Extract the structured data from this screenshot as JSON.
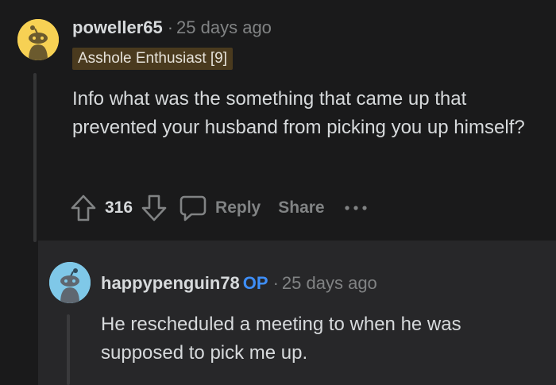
{
  "comment": {
    "username": "poweller65",
    "time_ago": "25 days ago",
    "flair": "Asshole Enthusiast [9]",
    "body": "Info what was the something that came up that prevented your husband from picking you up himself?",
    "vote_count": "316",
    "actions": {
      "reply": "Reply",
      "share": "Share",
      "more": "•••"
    },
    "avatar_color": "#f7d154"
  },
  "reply": {
    "username": "happypenguin78",
    "op_tag": "OP",
    "time_ago": "25 days ago",
    "body": "He rescheduled a meeting to when he was supposed to pick me up.",
    "avatar_color": "#7fc8e8"
  },
  "separator": "·",
  "colors": {
    "background": "#1a1a1b",
    "reply_background": "#272729",
    "op_tag": "#3e8ef7",
    "flair_background": "#4a3a1e",
    "muted_text": "#818384"
  },
  "icons": {
    "upvote": "arrow-up-icon",
    "downvote": "arrow-down-icon",
    "reply": "speech-bubble-icon",
    "more": "ellipsis-icon",
    "avatar": "snoo-avatar-icon"
  }
}
